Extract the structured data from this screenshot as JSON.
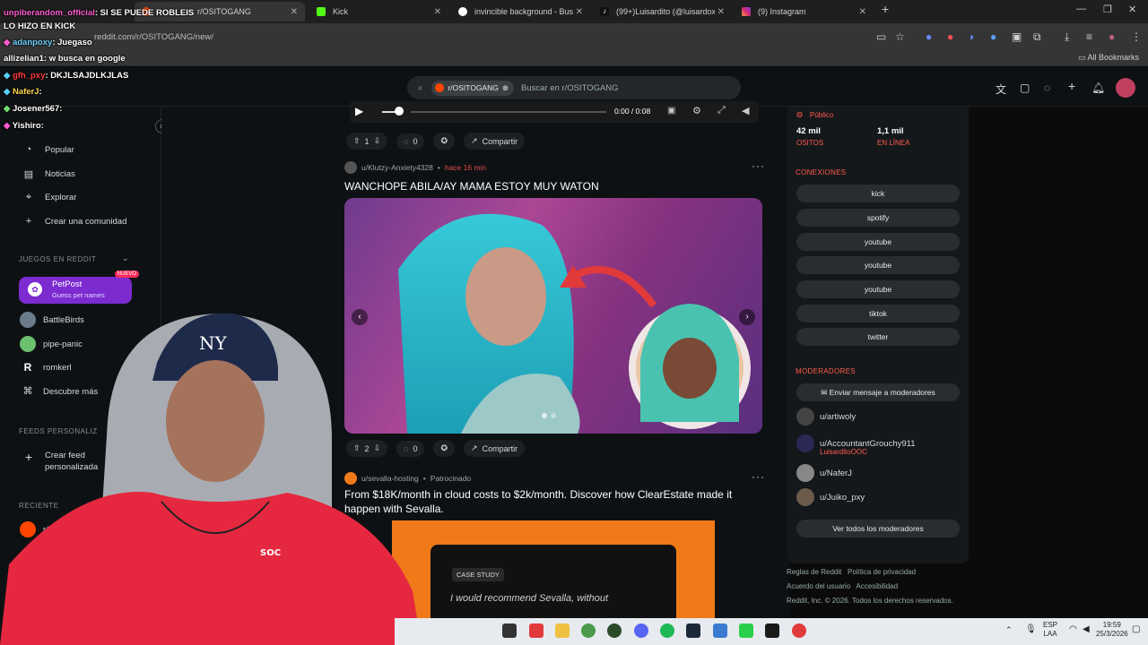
{
  "browser": {
    "tabs": [
      {
        "label": "r/OSITOGANG"
      },
      {
        "label": "Kick"
      },
      {
        "label": "invincible background - Buscar"
      },
      {
        "label": "(99+)Luisardito (@luisardox) | T"
      },
      {
        "label": "(9) Instagram"
      }
    ],
    "url": "reddit.com/r/OSITOGANG/new/",
    "all_bookmarks": "All Bookmarks"
  },
  "search": {
    "community_chip": "r/OSITOGANG",
    "placeholder": "Buscar en r/OSITOGANG"
  },
  "chat_overlay": [
    {
      "user": "unpiberandom_official",
      "msg": ": SI SE PUEDE ROBLEIS"
    },
    {
      "user": "",
      "msg": "LO HIZO EN KICK"
    },
    {
      "user": "adanpoxy",
      "msg": ": Juegaso"
    },
    {
      "user": "allizelian1",
      "msg": ": w busca en google"
    },
    {
      "user": "gfh_pxy",
      "msg": ": DKJLSAJDLKJLAS"
    },
    {
      "user": "NaferJ",
      "msg": ":"
    },
    {
      "user": "Josener567",
      "msg": ":"
    },
    {
      "user": "Yishiro",
      "msg": ":"
    }
  ],
  "left_nav": {
    "items": [
      {
        "label": "Popular",
        "icon": "trend-icon"
      },
      {
        "label": "Noticias",
        "icon": "news-icon"
      },
      {
        "label": "Explorar",
        "icon": "explore-icon"
      },
      {
        "label": "Crear una comunidad",
        "icon": "plus-icon"
      }
    ],
    "games_header": "JUEGOS EN REDDIT",
    "petpost": {
      "title": "PetPost",
      "subtitle": "Guess pet names",
      "badge": "NUEVO"
    },
    "games": [
      {
        "label": "BattleBirds"
      },
      {
        "label": "pipe-panic"
      },
      {
        "label": "romkerl"
      },
      {
        "label": "Descubre más"
      }
    ],
    "custom_feeds_header": "FEEDS PERSONALIZ",
    "create_feed": "Crear feed personalizada",
    "recent_header": "RECIENTE",
    "recent_item": "r/O"
  },
  "video_player": {
    "time": "0:00 / 0:08"
  },
  "posts": [
    {
      "votes": "1",
      "comments": "0",
      "share": "Compartir"
    },
    {
      "author": "u/Klutzy-Anxiety4328",
      "time": "hace 16 min",
      "title": "WANCHOPE ABILA/AY MAMA ESTOY MUY WATON",
      "votes": "2",
      "comments": "0",
      "share": "Compartir"
    }
  ],
  "ad": {
    "author": "u/sevalla-hosting",
    "tag": "Patrocinado",
    "title": "From $18K/month in cloud costs to $2k/month. Discover how ClearEstate made it happen with Sevalla.",
    "case_study": "CASE STUDY",
    "quote": "I would recommend Sevalla, without"
  },
  "right_sidebar": {
    "visibility": "Público",
    "members_value": "42 mil",
    "members_label": "OSITOS",
    "online_value": "1,1 mil",
    "online_label": "EN LÍNEA",
    "connections_header": "CONEXIONES",
    "connections": [
      "kick",
      "spotify",
      "youtube",
      "youtube",
      "youtube",
      "tiktok",
      "twitter"
    ],
    "moderators_header": "MODERADORES",
    "message_mods": "Enviar mensaje a moderadores",
    "moderators": [
      {
        "name": "u/artiwoly"
      },
      {
        "name": "u/AccountantGrouchy911",
        "flair": "LuisarditoOOC"
      },
      {
        "name": "u/NaferJ"
      },
      {
        "name": "u/Juiko_pxy"
      }
    ],
    "view_all_mods": "Ver todos los moderadores"
  },
  "footer": {
    "links_row1": [
      "Reglas de Reddit",
      "Política de privacidad"
    ],
    "links_row2": [
      "Acuerdo del usuario",
      "Accesibilidad"
    ],
    "copyright": "Reddit, Inc. © 2026. Todos los derechos reservados."
  },
  "taskbar": {
    "lang_top": "ESP",
    "lang_bottom": "LAA",
    "time": "19:59",
    "date": "25/3/2026"
  },
  "colors": {
    "reddit_orange": "#ff4500",
    "accent_red": "#ff5a4a",
    "petpost_purple": "#7b2bd0"
  }
}
